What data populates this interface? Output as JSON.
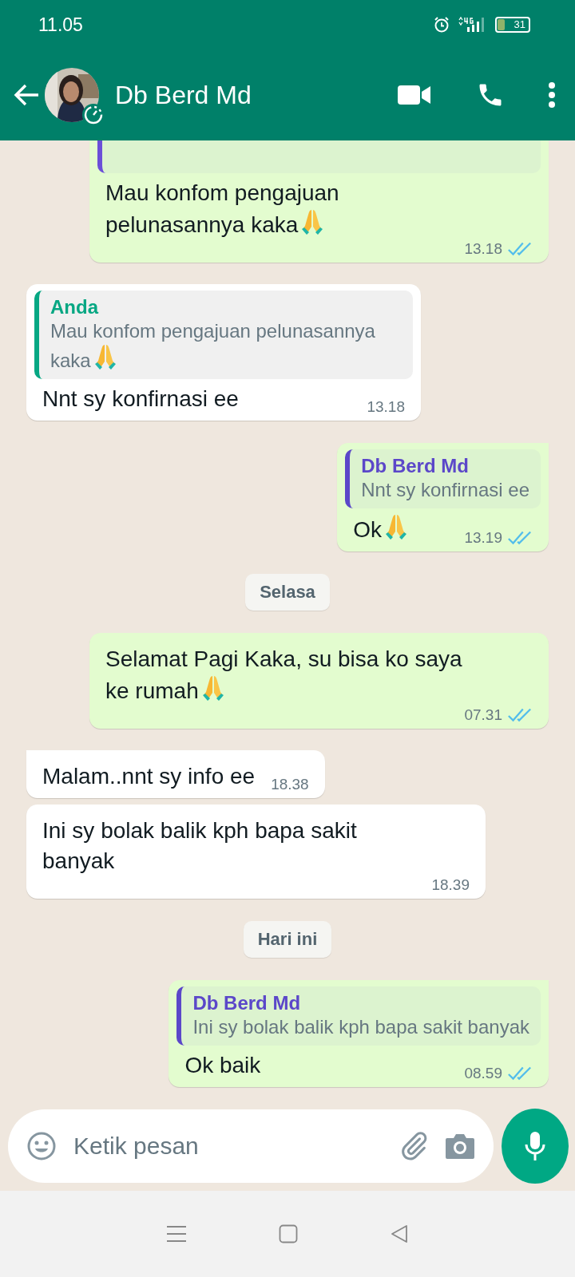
{
  "status_bar": {
    "time": "11.05",
    "battery": "31"
  },
  "header": {
    "contact_name": "Db Berd Md"
  },
  "messages": [
    {
      "kind": "bubble",
      "outgoing": true,
      "quote": {
        "color": "#6b4fd8"
      },
      "text": "Mau konfom pengajuan pelunasannya kaka",
      "emoji": true,
      "time": "13.18",
      "read": true
    },
    {
      "kind": "bubble",
      "outgoing": false,
      "quote": {
        "author": "Anda",
        "text": "Mau konfom pengajuan pelunasannya kaka",
        "emoji": true,
        "color": "#06a783"
      },
      "text": "Nnt sy konfirnasi ee",
      "emoji": false,
      "time": "13.18"
    },
    {
      "kind": "bubble",
      "outgoing": true,
      "tail": true,
      "quote": {
        "author": "Db Berd Md",
        "text": "Nnt sy konfirnasi ee",
        "emoji": false,
        "color": "#5b47c9"
      },
      "text": "Ok",
      "emoji": true,
      "time": "13.19",
      "read": true
    },
    {
      "kind": "date",
      "text": "Selasa"
    },
    {
      "kind": "bubble",
      "outgoing": true,
      "text": "Selamat Pagi Kaka, su bisa ko saya ke rumah",
      "emoji": true,
      "time": "07.31",
      "read": true
    },
    {
      "kind": "bubble",
      "outgoing": false,
      "tail": true,
      "text": "Malam..nnt sy info ee",
      "emoji": false,
      "time": "18.38"
    },
    {
      "kind": "bubble",
      "outgoing": false,
      "text": "Ini sy bolak balik kph bapa sakit banyak",
      "emoji": false,
      "time": "18.39"
    },
    {
      "kind": "date",
      "text": "Hari ini"
    },
    {
      "kind": "bubble",
      "outgoing": true,
      "tail": true,
      "quote": {
        "author": "Db Berd Md",
        "text": "Ini sy bolak balik kph bapa sakit banyak",
        "emoji": false,
        "color": "#5b47c9"
      },
      "text": "Ok baik",
      "emoji": false,
      "time": "08.59",
      "read": true
    }
  ],
  "composer": {
    "placeholder": "Ketik pesan"
  }
}
